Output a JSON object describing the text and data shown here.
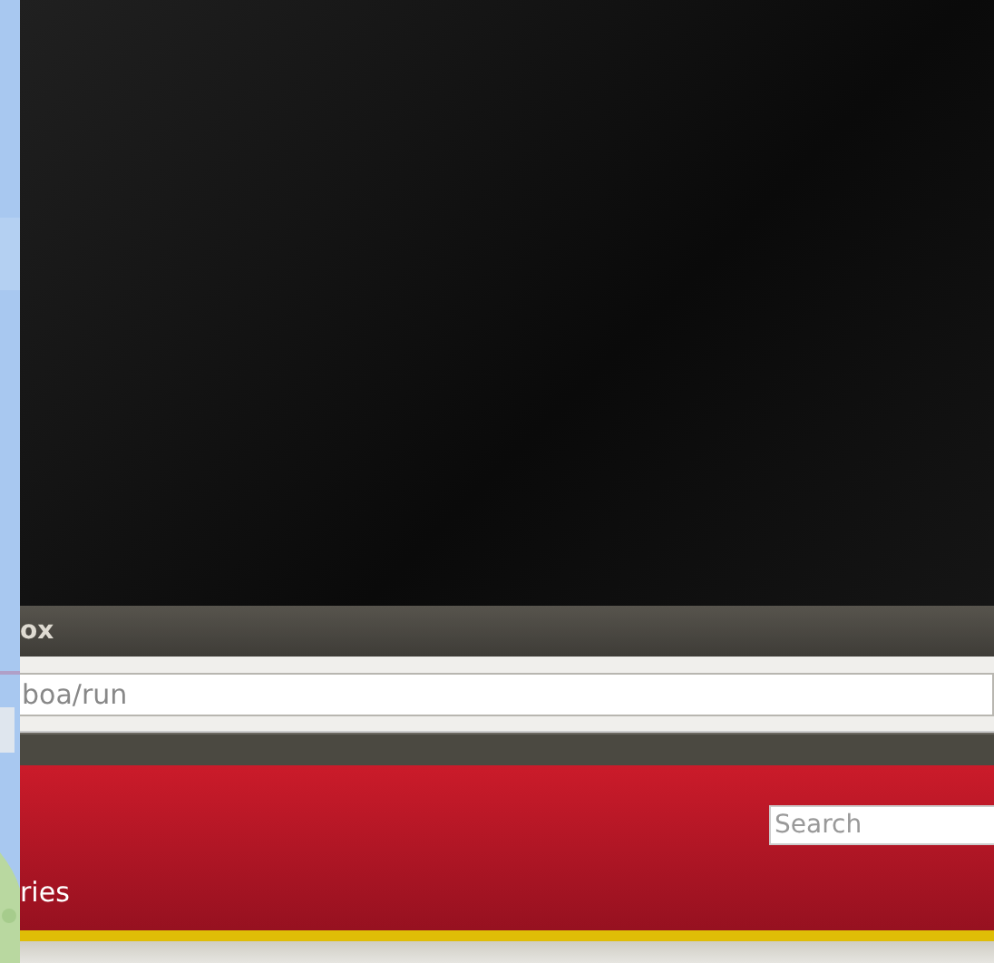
{
  "window": {
    "title": "ox"
  },
  "address_bar": {
    "value": "boa/run"
  },
  "site_header": {
    "search": {
      "placeholder": "Search"
    },
    "nav_label": "ries"
  }
}
